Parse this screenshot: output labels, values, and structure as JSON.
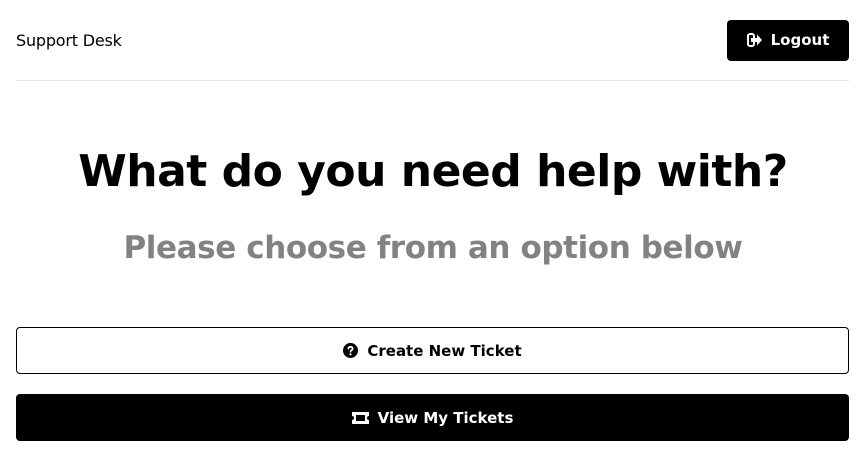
{
  "header": {
    "brand": "Support Desk",
    "logout_label": "Logout",
    "logout_icon": "sign-out-icon"
  },
  "main": {
    "heading": "What do you need help with?",
    "subheading": "Please choose from an option below",
    "create_ticket": {
      "label": "Create New Ticket",
      "icon": "question-circle-icon"
    },
    "view_tickets": {
      "label": "View My Tickets",
      "icon": "ticket-icon"
    }
  },
  "colors": {
    "primary": "#000000",
    "background": "#ffffff",
    "subheading": "#828282",
    "divider": "#e6e6e6"
  }
}
